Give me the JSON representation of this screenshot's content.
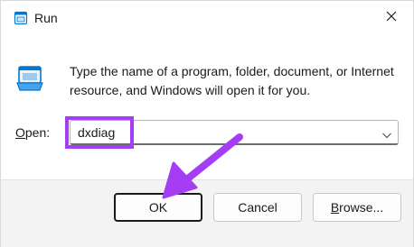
{
  "window": {
    "title": "Run"
  },
  "dialog": {
    "description": "Type the name of a program, folder, document, or Internet resource, and Windows will open it for you.",
    "open_label_mnemonic": "O",
    "open_label_rest": "pen:",
    "open_value": "dxdiag"
  },
  "buttons": {
    "ok": "OK",
    "cancel": "Cancel",
    "browse_mnemonic": "B",
    "browse_rest": "rowse..."
  },
  "colors": {
    "highlight": "#a53df5",
    "arrow": "#a53df5",
    "icon_blue": "#0078d4"
  },
  "icons": {
    "title": "run-icon",
    "app": "run-icon",
    "close": "close-icon",
    "dropdown": "chevron-down-icon"
  }
}
